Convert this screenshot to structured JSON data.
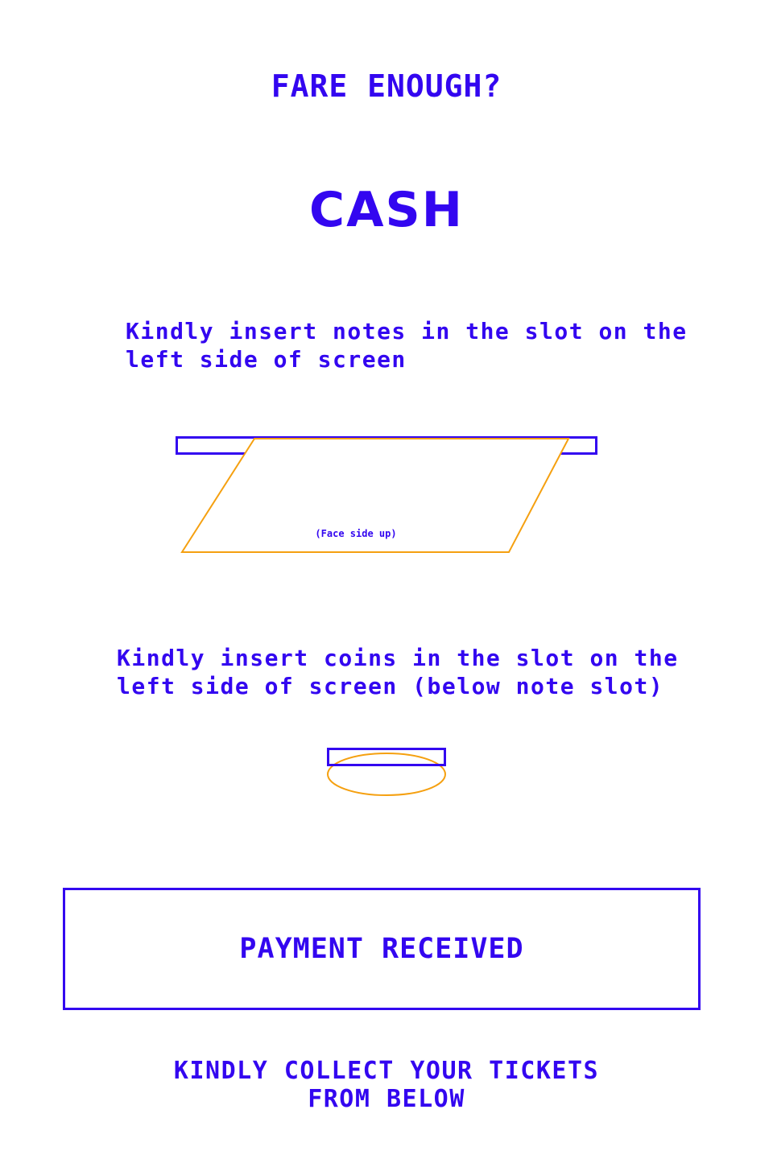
{
  "header": {
    "app_title": "FARE ENOUGH?",
    "screen_title": "CASH"
  },
  "notes": {
    "instruction": "Kindly insert notes in the slot on the\nleft side of screen",
    "orientation_hint": "(Face side up)"
  },
  "coins": {
    "instruction": "Kindly insert coins in the slot on the\nleft side of screen (below note slot)"
  },
  "status": {
    "label": "PAYMENT RECEIVED"
  },
  "footer": {
    "line1": "KINDLY COLLECT YOUR TICKETS",
    "line2": "FROM BELOW"
  },
  "colors": {
    "primary": "#3306f0",
    "accent": "#f5a010",
    "background": "#ffffff"
  }
}
